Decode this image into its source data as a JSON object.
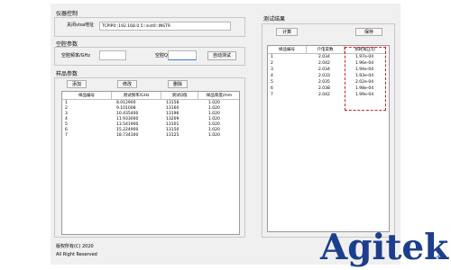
{
  "instrument": {
    "title": "仪器控制",
    "visa_label": "关闭visa地址",
    "visa_address": "TCPIP0::192.168.0.5::inst0::INSTR"
  },
  "cavity": {
    "title": "空腔参数",
    "freq_label": "空腔频率/GHz",
    "freq_value": "",
    "q_label": "空腔Q",
    "q_value": "",
    "auto_test_label": "自动测试"
  },
  "sample": {
    "title": "样品参数",
    "add_label": "添加",
    "modify_label": "修改",
    "delete_label": "删除",
    "columns": [
      "样品编号",
      "测试频率/GHz",
      "测试Q值",
      "样品厚度/mm"
    ],
    "rows": [
      [
        "1",
        "8.012900",
        "13158",
        "1.020"
      ],
      [
        "2",
        "9.101008",
        "13160",
        "1.020"
      ],
      [
        "3",
        "10.435400",
        "13196",
        "1.020"
      ],
      [
        "4",
        "11.933000",
        "13209",
        "1.020"
      ],
      [
        "5",
        "13.541900",
        "13101",
        "1.020"
      ],
      [
        "6",
        "15.224900",
        "13150",
        "1.020"
      ],
      [
        "7",
        "18.734300",
        "13125",
        "1.020"
      ]
    ]
  },
  "results": {
    "title": "测试结果",
    "calc_label": "计算",
    "save_label": "保存",
    "columns": [
      "样品编号",
      "介电常数",
      "损耗角正切"
    ],
    "rows": [
      [
        "1",
        "2.034",
        "1.97e-04"
      ],
      [
        "2",
        "2.042",
        "1.96e-04"
      ],
      [
        "3",
        "2.034",
        "1.94e-04"
      ],
      [
        "4",
        "2.033",
        "1.93e-04"
      ],
      [
        "5",
        "2.035",
        "2.02e-04"
      ],
      [
        "6",
        "2.038",
        "1.98e-04"
      ],
      [
        "7",
        "2.042",
        "1.99e-04"
      ]
    ]
  },
  "footer": {
    "copyright": "版权所有(C) 2020",
    "rights": "All Right Reserved"
  },
  "brand": {
    "logo": "Agitek",
    "registered": "®",
    "color": "#1c3e8c",
    "highlight_color": "#d21f1f"
  }
}
